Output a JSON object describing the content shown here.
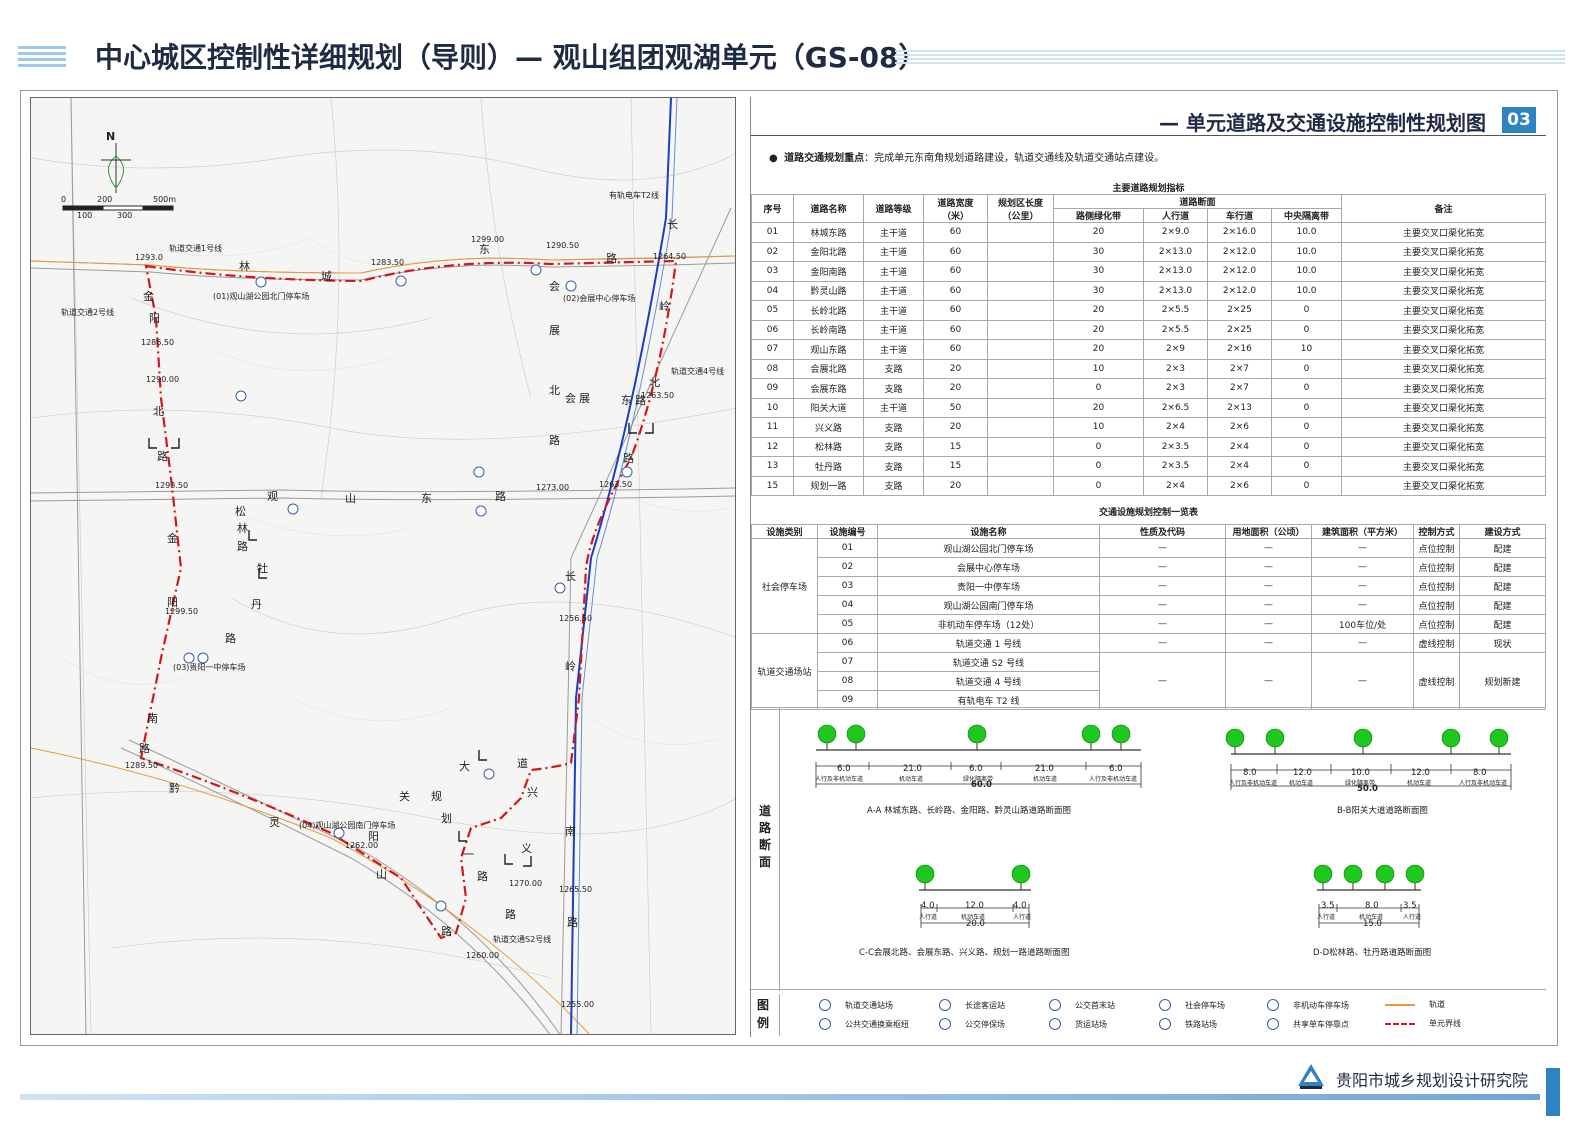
{
  "header": {
    "title": "中心城区控制性详细规划（导则）— 观山组团观湖单元（GS-08）"
  },
  "section": {
    "title": "— 单元道路及交通设施控制性规划图",
    "badge": "03"
  },
  "focus": {
    "label": "道路交通规划重点",
    "text": "：完成单元东南角规划道路建设，轨道交通线及轨道交通站点建设。"
  },
  "map": {
    "north": "N",
    "scale_top": [
      "0",
      "200",
      "500m"
    ],
    "scale_bottom": [
      "100",
      "300"
    ],
    "labels": [
      "轨道交通1号线",
      "轨道交通2号线",
      "轨道交通4号线",
      "有轨电车T2线",
      "轨道交通S2号线",
      "(01)观山湖公园北门停车场",
      "(02)会展中心停车场",
      "(03)贵阳一中停车场",
      "(04)观山湖公园南门停车场",
      "1293.0",
      "1283.50",
      "1299.00",
      "1290.50",
      "1264.50",
      "1286.50",
      "1290.00",
      "1263.50",
      "1273.00",
      "1293.50",
      "1263.50",
      "1299.50",
      "1256.50",
      "1289.50",
      "1262.00",
      "1270.00",
      "1265.50",
      "1260.00",
      "1255.00"
    ],
    "road_chars": [
      "林",
      "城",
      "东",
      "路",
      "金",
      "阳",
      "北",
      "路",
      "会",
      "展",
      "北",
      "路",
      "会",
      "展",
      "东",
      "路",
      "长",
      "岭",
      "北",
      "路",
      "观",
      "山",
      "东",
      "路",
      "松",
      "林",
      "路",
      "牡",
      "丹",
      "路",
      "金",
      "阳",
      "南",
      "路",
      "黔",
      "灵",
      "山",
      "路",
      "阳",
      "关",
      "大",
      "道",
      "规",
      "划",
      "一",
      "路",
      "兴",
      "义",
      "路",
      "长",
      "岭",
      "南",
      "路"
    ]
  },
  "road_table": {
    "caption": "主要道路规划指标",
    "headers": {
      "no": "序号",
      "name": "道路名称",
      "grade": "道路等级",
      "width": "道路宽度",
      "width_unit": "（米）",
      "length": "规划区长度",
      "length_unit": "（公里）",
      "section": "道路断面",
      "green": "路侧绿化带",
      "walk": "人行道",
      "lane": "车行道",
      "median": "中央隔离带",
      "note": "备注"
    },
    "rows": [
      [
        "01",
        "林城东路",
        "主干道",
        "60",
        "",
        "20",
        "2×9.0",
        "2×16.0",
        "10.0",
        "主要交叉口渠化拓宽"
      ],
      [
        "02",
        "金阳北路",
        "主干道",
        "60",
        "",
        "30",
        "2×13.0",
        "2×12.0",
        "10.0",
        "主要交叉口渠化拓宽"
      ],
      [
        "03",
        "金阳南路",
        "主干道",
        "60",
        "",
        "30",
        "2×13.0",
        "2×12.0",
        "10.0",
        "主要交叉口渠化拓宽"
      ],
      [
        "04",
        "黔灵山路",
        "主干道",
        "60",
        "",
        "30",
        "2×13.0",
        "2×12.0",
        "10.0",
        "主要交叉口渠化拓宽"
      ],
      [
        "05",
        "长岭北路",
        "主干道",
        "60",
        "",
        "20",
        "2×5.5",
        "2×25",
        "0",
        "主要交叉口渠化拓宽"
      ],
      [
        "06",
        "长岭南路",
        "主干道",
        "60",
        "",
        "20",
        "2×5.5",
        "2×25",
        "0",
        "主要交叉口渠化拓宽"
      ],
      [
        "07",
        "观山东路",
        "主干道",
        "60",
        "",
        "20",
        "2×9",
        "2×16",
        "10",
        "主要交叉口渠化拓宽"
      ],
      [
        "08",
        "会展北路",
        "支路",
        "20",
        "",
        "10",
        "2×3",
        "2×7",
        "0",
        "主要交叉口渠化拓宽"
      ],
      [
        "09",
        "会展东路",
        "支路",
        "20",
        "",
        "0",
        "2×3",
        "2×7",
        "0",
        "主要交叉口渠化拓宽"
      ],
      [
        "10",
        "阳关大道",
        "主干道",
        "50",
        "",
        "20",
        "2×6.5",
        "2×13",
        "0",
        "主要交叉口渠化拓宽"
      ],
      [
        "11",
        "兴义路",
        "支路",
        "20",
        "",
        "10",
        "2×4",
        "2×6",
        "0",
        "主要交叉口渠化拓宽"
      ],
      [
        "12",
        "松林路",
        "支路",
        "15",
        "",
        "0",
        "2×3.5",
        "2×4",
        "0",
        "主要交叉口渠化拓宽"
      ],
      [
        "13",
        "牡丹路",
        "支路",
        "15",
        "",
        "0",
        "2×3.5",
        "2×4",
        "0",
        "主要交叉口渠化拓宽"
      ],
      [
        "15",
        "规划一路",
        "支路",
        "20",
        "",
        "0",
        "2×4",
        "2×6",
        "0",
        "主要交叉口渠化拓宽"
      ]
    ]
  },
  "facility_table": {
    "caption": "交通设施规划控制一览表",
    "headers": [
      "设施类别",
      "设施编号",
      "设施名称",
      "性质及代码",
      "用地面积（公顷）",
      "建筑面积（平方米）",
      "控制方式",
      "建设方式"
    ],
    "group_parking": "社会停车场",
    "group_rail": "轨道交通场站",
    "parking_rows": [
      [
        "01",
        "观山湖公园北门停车场",
        "—",
        "—",
        "—",
        "点位控制",
        "配建"
      ],
      [
        "02",
        "会展中心停车场",
        "—",
        "—",
        "—",
        "点位控制",
        "配建"
      ],
      [
        "03",
        "贵阳一中停车场",
        "—",
        "—",
        "—",
        "点位控制",
        "配建"
      ],
      [
        "04",
        "观山湖公园南门停车场",
        "—",
        "—",
        "—",
        "点位控制",
        "配建"
      ],
      [
        "05",
        "非机动车停车场（12处）",
        "—",
        "—",
        "100车位/处",
        "点位控制",
        "配建"
      ]
    ],
    "rail_first": [
      "06",
      "轨道交通 1 号线",
      "—",
      "—",
      "—",
      "虚线控制",
      "现状"
    ],
    "rail_rest": [
      [
        "07",
        "轨道交通 S2 号线"
      ],
      [
        "08",
        "轨道交通 4 号线"
      ],
      [
        "09",
        "有轨电车 T2 线"
      ]
    ],
    "rail_merged": [
      "—",
      "—",
      "—",
      "虚线控制",
      "规划新建"
    ]
  },
  "sections": {
    "label": [
      "道",
      "路",
      "断",
      "面"
    ],
    "aa": {
      "caption": "A-A 林城东路、长岭路、金阳路、黔灵山路道路断面图",
      "dims": [
        "6.0",
        "21.0",
        "6.0",
        "21.0",
        "6.0"
      ],
      "total": "60.0",
      "parts": [
        "人行及非机动车道",
        "机动车道",
        "绿化隔离带",
        "机动车道",
        "人行及非机动车道"
      ]
    },
    "bb": {
      "caption": "B-B阳关大道道路断面图",
      "dims": [
        "8.0",
        "12.0",
        "10.0",
        "12.0",
        "8.0"
      ],
      "total": "50.0",
      "parts": [
        "人行及非机动车道",
        "机动车道",
        "绿化隔离带",
        "机动车道",
        "人行及非机动车道"
      ]
    },
    "cc": {
      "caption": "C-C会展北路、会展东路、兴义路、规划一路道路断面图",
      "dims": [
        "4.0",
        "12.0",
        "4.0"
      ],
      "total": "20.0",
      "parts": [
        "人行道",
        "机动车道",
        "人行道"
      ]
    },
    "dd": {
      "caption": "D-D松林路、牡丹路道路断面图",
      "dims": [
        "3.5",
        "8.0",
        "3.5"
      ],
      "total": "15.0",
      "parts": [
        "人行道",
        "机动车道",
        "人行道"
      ]
    }
  },
  "legend": {
    "label": [
      "图",
      "例"
    ],
    "items": [
      "轨道交通站场",
      "长途客运站",
      "公交首末站",
      "社会停车场",
      "非机动车停车场",
      "轨道",
      "公共交通换乘枢纽",
      "公交停保场",
      "货运站场",
      "铁路站场",
      "共享单车停靠点",
      "单元界线"
    ]
  },
  "footer": {
    "org": "贵阳市城乡规划设计研究院"
  },
  "colors": {
    "accent": "#2e83c2",
    "boundary": "#d0181c",
    "rail": "#1a3fbf",
    "title": "#1f2a44"
  }
}
